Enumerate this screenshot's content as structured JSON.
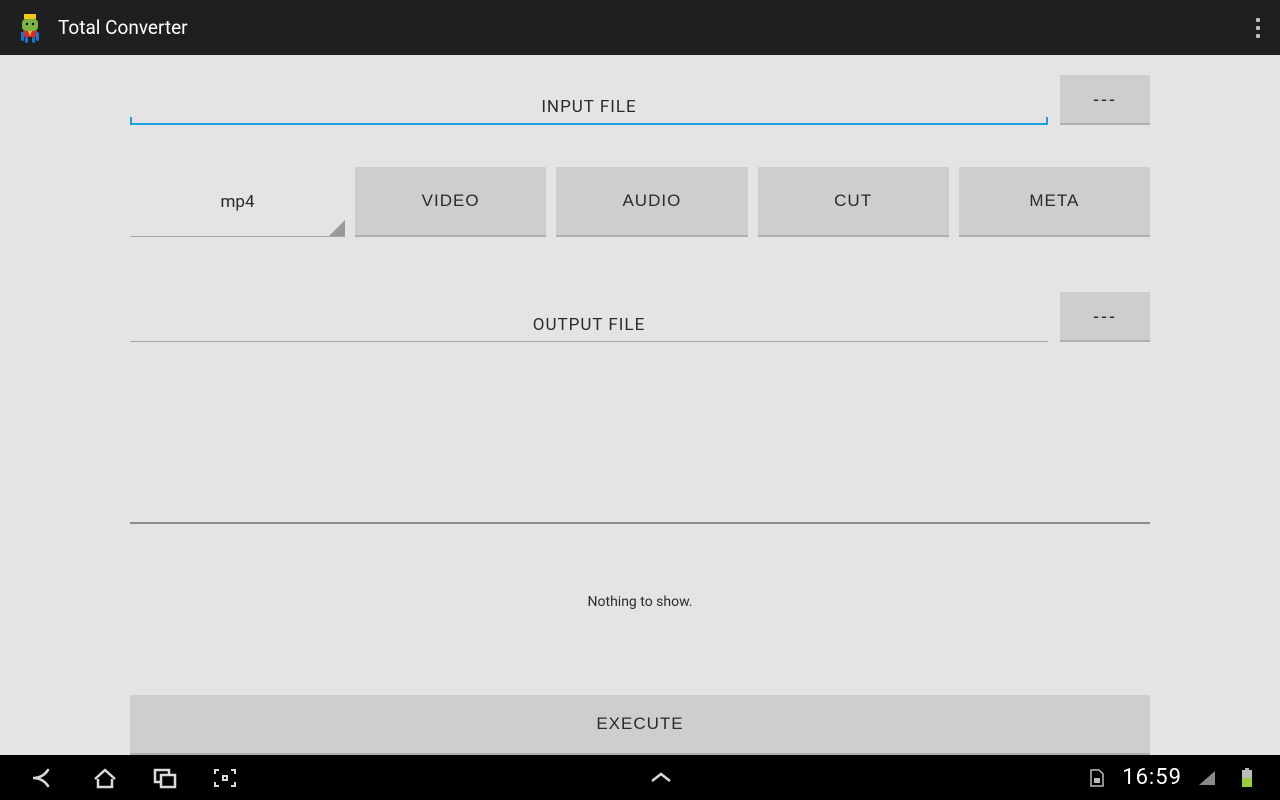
{
  "actionbar": {
    "title": "Total Converter"
  },
  "input": {
    "label": "INPUT FILE",
    "browse_button": "---"
  },
  "format": {
    "selected": "mp4"
  },
  "tabs": {
    "video": "VIDEO",
    "audio": "AUDIO",
    "cut": "CUT",
    "meta": "META"
  },
  "output": {
    "label": "OUTPUT FILE",
    "browse_button": "---"
  },
  "status": {
    "message": "Nothing to show."
  },
  "execute": {
    "label": "EXECUTE"
  },
  "system": {
    "clock": "16:59"
  }
}
